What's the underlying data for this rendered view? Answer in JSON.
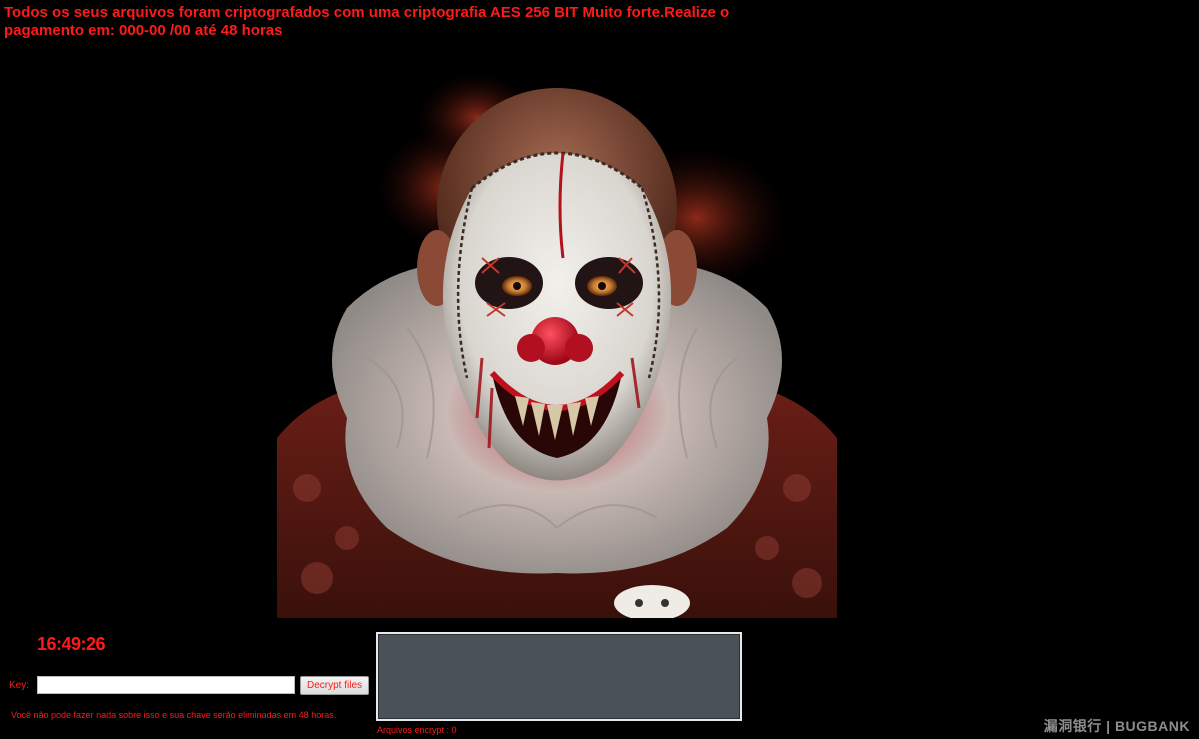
{
  "header": {
    "message": "Todos os seus arquivos foram criptografados com uma criptografia AES 256 BIT Muito forte.Realize o pagamento em: 000-00 /00   até 48 horas"
  },
  "image": {
    "subject": "clown-portrait"
  },
  "timer": {
    "value": "16:49:26"
  },
  "key_form": {
    "label": "Key:",
    "input_value": "",
    "button_label": "Decrypt files"
  },
  "warning": {
    "text": "Você não pode fazer nada sobre isso e sua chave serão eliminadas em 48 horas."
  },
  "log": {
    "count_text": "Arquivos encrypt : 0"
  },
  "watermark": {
    "text": "漏洞银行 | BUGBANK"
  },
  "colors": {
    "background": "#000000",
    "accent_red": "#ff1a1a",
    "log_box": "#4a5157"
  }
}
